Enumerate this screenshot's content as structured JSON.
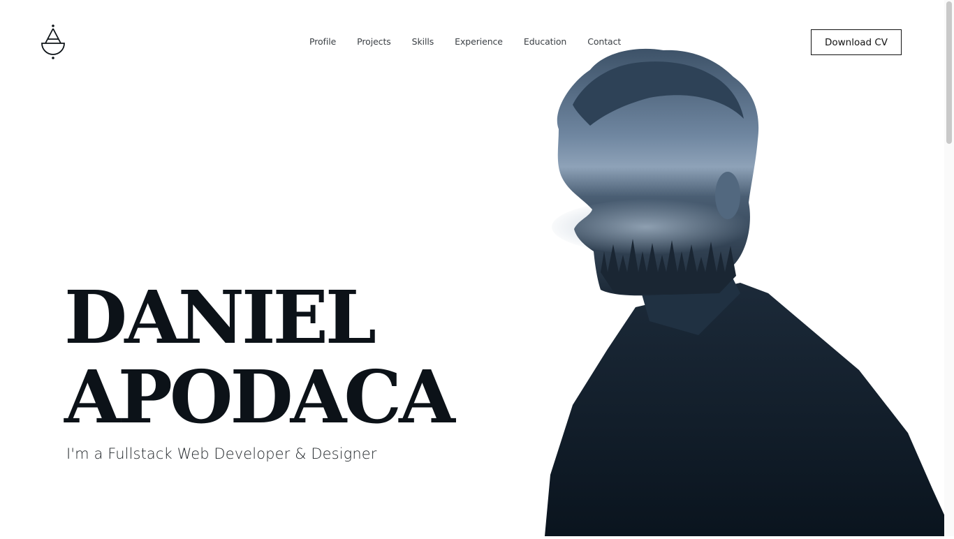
{
  "logo": {
    "icon": "monogram-a-icon"
  },
  "nav": {
    "items": [
      {
        "label": "Profile"
      },
      {
        "label": "Projects"
      },
      {
        "label": "Skills"
      },
      {
        "label": "Experience"
      },
      {
        "label": "Education"
      },
      {
        "label": "Contact"
      }
    ]
  },
  "header": {
    "cta_label": "Download CV"
  },
  "hero": {
    "first_name": "DANIEL",
    "last_name": "APODACA",
    "tagline": "I'm a Fullstack Web Developer & Designer",
    "portrait_icon": "portrait-silhouette-image"
  },
  "colors": {
    "text": "#0c1218",
    "accent_dark": "#0d1a26",
    "portrait_light": "#7d95ad",
    "background": "#ffffff"
  }
}
